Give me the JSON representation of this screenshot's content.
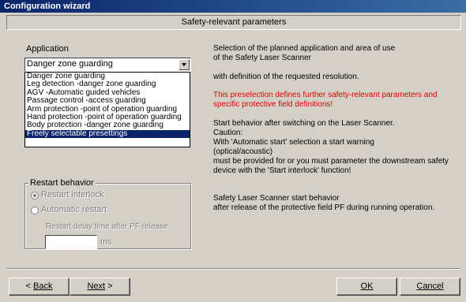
{
  "window": {
    "title": "Configuration wizard"
  },
  "header": {
    "title": "Safety-relevant parameters"
  },
  "application": {
    "label": "Application",
    "selected": "Danger zone guarding",
    "options": [
      "Danger zone guarding",
      "Leg detection  -danger zone guarding",
      "AGV  -Automatic guided vehicles",
      "Passage control  -access guarding",
      "Arm protection  -point of operation guarding",
      "Hand protection  -point of operation guarding",
      "Body protection  -danger zone guarding",
      "Freely selectable presettings"
    ],
    "highlighted_index": 7
  },
  "info": {
    "line1": "Selection of the planned application and area of use",
    "line2": "of the Safety Laser Scanner",
    "line3": "with definition of the requested resolution.",
    "warn1": "This preselection defines further safety-relevant parameters and",
    "warn2": "specific protective field definitions!",
    "start1": "Start behavior after switching on the Laser Scanner.",
    "start2": "Caution:",
    "start3": "With 'Automatic start' selection a start warning",
    "start4": "(optical/acoustic)",
    "start5": "must be provided for or you must parameter the downstream safety",
    "start6": "device with the 'Start interlock' function!",
    "restart1": "Safety Laser Scanner start behavior",
    "restart2": "after release of the protective field PF during running operation."
  },
  "restart": {
    "group_label": "Restart behavior",
    "option1": "Restart interlock",
    "option2": "Automatic restart",
    "selected": "Restart interlock",
    "delay_label": "Restart delay time after PF release",
    "delay_value": "",
    "delay_unit": "ms"
  },
  "buttons": {
    "back_prefix": "< ",
    "back_label": "Back",
    "next_label": "Next",
    "next_suffix": " >",
    "ok_label": "OK",
    "cancel_label": "Cancel"
  }
}
